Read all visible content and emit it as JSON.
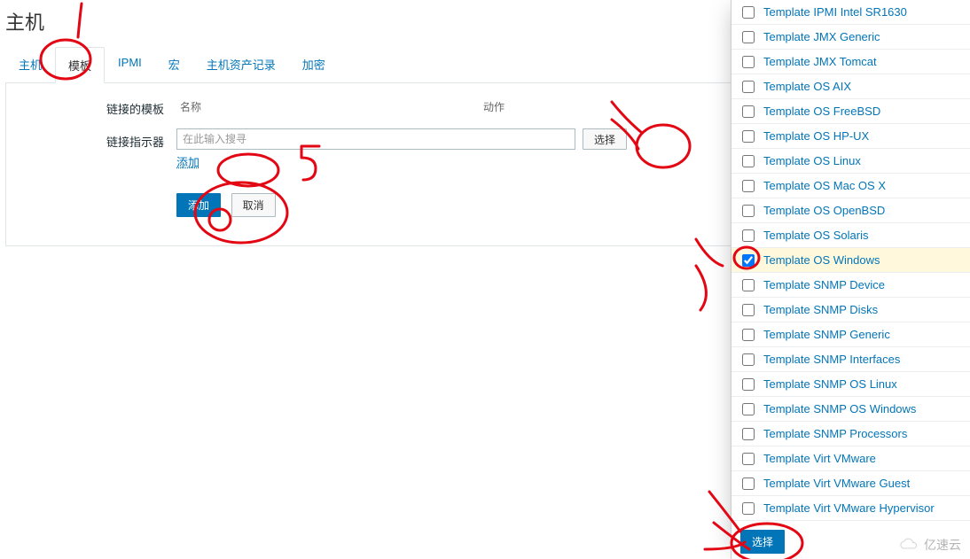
{
  "page_title": "主机",
  "tabs": [
    {
      "id": "host",
      "label": "主机",
      "active": false
    },
    {
      "id": "template",
      "label": "模板",
      "active": true
    },
    {
      "id": "ipmi",
      "label": "IPMI",
      "active": false
    },
    {
      "id": "macro",
      "label": "宏",
      "active": false
    },
    {
      "id": "inventory",
      "label": "主机资产记录",
      "active": false
    },
    {
      "id": "encrypt",
      "label": "加密",
      "active": false
    }
  ],
  "form": {
    "linked_templates_label": "链接的模板",
    "linked_col_name": "名称",
    "linked_col_action": "动作",
    "link_indicator_label": "链接指示器",
    "search_placeholder": "在此输入搜寻",
    "select_btn": "选择",
    "small_add": "添加",
    "submit_add": "添加",
    "cancel": "取消"
  },
  "picker": {
    "checked_index": 10,
    "footer_select": "选择",
    "items": [
      "Template IPMI Intel SR1630",
      "Template JMX Generic",
      "Template JMX Tomcat",
      "Template OS AIX",
      "Template OS FreeBSD",
      "Template OS HP-UX",
      "Template OS Linux",
      "Template OS Mac OS X",
      "Template OS OpenBSD",
      "Template OS Solaris",
      "Template OS Windows",
      "Template SNMP Device",
      "Template SNMP Disks",
      "Template SNMP Generic",
      "Template SNMP Interfaces",
      "Template SNMP OS Linux",
      "Template SNMP OS Windows",
      "Template SNMP Processors",
      "Template Virt VMware",
      "Template Virt VMware Guest",
      "Template Virt VMware Hypervisor"
    ]
  },
  "watermark": "亿速云"
}
